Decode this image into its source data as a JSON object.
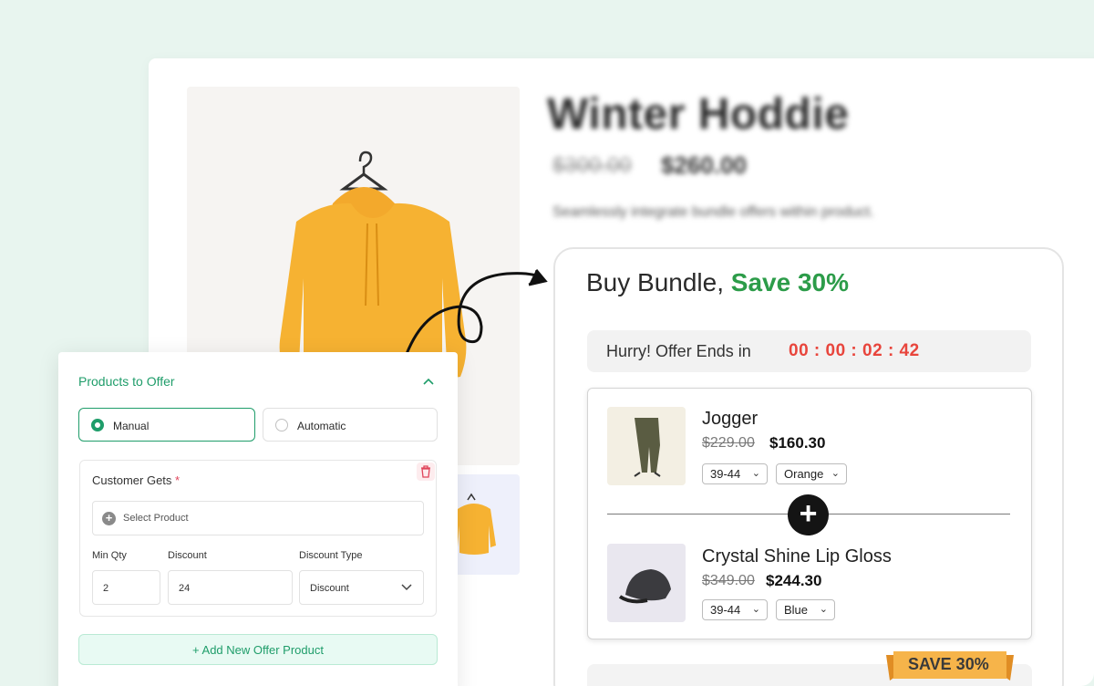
{
  "product": {
    "title": "Winter Hoddie",
    "old_price": "$300.00",
    "new_price": "$260.00",
    "description": "Seamlessly integrate bundle offers within product."
  },
  "bundle": {
    "title_prefix": "Buy Bundle,",
    "title_save": "Save 30%",
    "timer_label": "Hurry! Offer Ends in",
    "timer_value": "00 : 00 : 02 : 42",
    "items": [
      {
        "name": "Jogger",
        "old_price": "$229.00",
        "new_price": "$160.30",
        "size": "39-44",
        "color": "Orange"
      },
      {
        "name": "Crystal Shine Lip Gloss",
        "old_price": "$349.00",
        "new_price": "$244.30",
        "size": "39-44",
        "color": "Blue"
      }
    ],
    "plus_symbol": "+",
    "ribbon_text": "SAVE 30%"
  },
  "admin": {
    "section_title": "Products to Offer",
    "modes": {
      "manual": "Manual",
      "automatic": "Automatic",
      "selected": "Manual"
    },
    "customer_gets_label": "Customer Gets",
    "required_mark": "*",
    "select_product_placeholder": "Select Product",
    "min_qty_label": "Min Qty",
    "min_qty_value": "2",
    "discount_label": "Discount",
    "discount_value": "24",
    "discount_type_label": "Discount Type",
    "discount_type_value": "Discount",
    "add_offer_label": "+  Add New Offer Product"
  },
  "colors": {
    "accent_green": "#1f9d6a",
    "save_green": "#2c9c49",
    "timer_red": "#e8453c",
    "ribbon_orange": "#f6b44a"
  }
}
